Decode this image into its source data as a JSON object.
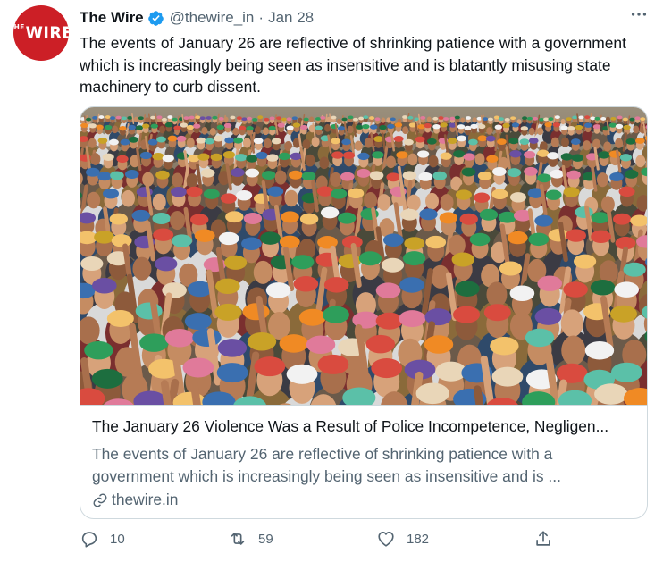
{
  "account": {
    "name": "The Wire",
    "handle": "@thewire_in",
    "separator": "·",
    "date": "Jan 28",
    "avatar_logo": "WIRE",
    "avatar_logo_prefix": "THE"
  },
  "tweet": {
    "text": "The events of January 26 are reflective of shrinking patience with a government which is increasingly being seen as insensitive and is blatantly misusing state machinery to curb dissent."
  },
  "card": {
    "title": "The January 26 Violence Was a Result of Police Incompetence, Negligen...",
    "description": "The events of January 26 are reflective of shrinking patience with a government which is increasingly being seen as insensitive and is ...",
    "domain": "thewire.in"
  },
  "actions": {
    "replies": "10",
    "retweets": "59",
    "likes": "182"
  },
  "icons": {
    "verified": "verified-badge-icon",
    "more": "more-dots-icon",
    "reply": "reply-icon",
    "retweet": "retweet-icon",
    "like": "heart-icon",
    "share": "share-icon",
    "link": "link-icon"
  },
  "colors": {
    "brand_red": "#cc1f26",
    "verified_blue": "#1d9bf0",
    "secondary_text": "#536471",
    "border": "#cfd9de"
  }
}
